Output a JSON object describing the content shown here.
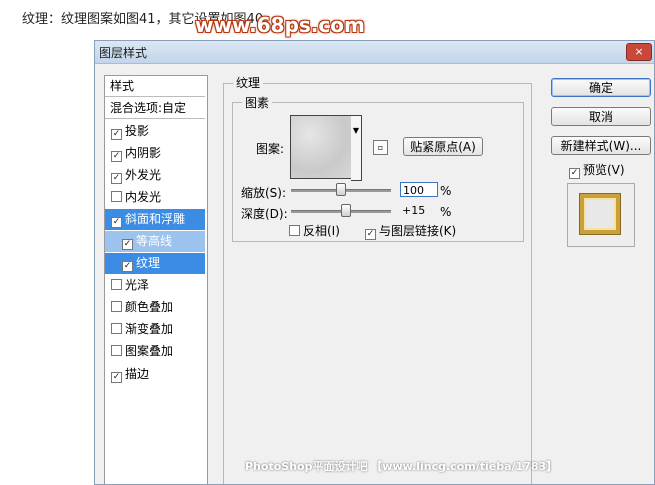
{
  "caption": "纹理：纹理图案如图41，其它设置如图40。",
  "watermark": "www.68ps.com",
  "dialog": {
    "title": "图层样式",
    "close": "×"
  },
  "styles_panel": {
    "header": "样式",
    "blend_options": "混合选项:自定",
    "items": [
      {
        "label": "投影",
        "checked": true
      },
      {
        "label": "内阴影",
        "checked": true
      },
      {
        "label": "外发光",
        "checked": true
      },
      {
        "label": "内发光",
        "checked": false
      },
      {
        "label": "斜面和浮雕",
        "checked": true
      },
      {
        "label": "等高线",
        "checked": true
      },
      {
        "label": "纹理",
        "checked": true
      },
      {
        "label": "光泽",
        "checked": false
      },
      {
        "label": "颜色叠加",
        "checked": false
      },
      {
        "label": "渐变叠加",
        "checked": false
      },
      {
        "label": "图案叠加",
        "checked": false
      },
      {
        "label": "描边",
        "checked": true
      }
    ]
  },
  "texture": {
    "section_title": "纹理",
    "group_title": "图素",
    "pattern_label": "图案:",
    "snap_button": "贴紧原点(A)",
    "scale_label": "缩放(S):",
    "scale_value": "100",
    "scale_unit": "%",
    "scale_fraction": 0.5,
    "depth_label": "深度(D):",
    "depth_value": "+15",
    "depth_unit": "%",
    "depth_fraction": 0.55,
    "invert_label": "反相(I)",
    "invert_checked": false,
    "link_label": "与图层链接(K)",
    "link_checked": true
  },
  "buttons": {
    "ok": "确定",
    "cancel": "取消",
    "new_style": "新建样式(W)...",
    "preview_label": "预览(V)",
    "preview_checked": true
  },
  "footer": "PhotoShop平面设计吧 【www.lincg.com/tieba/1783】"
}
